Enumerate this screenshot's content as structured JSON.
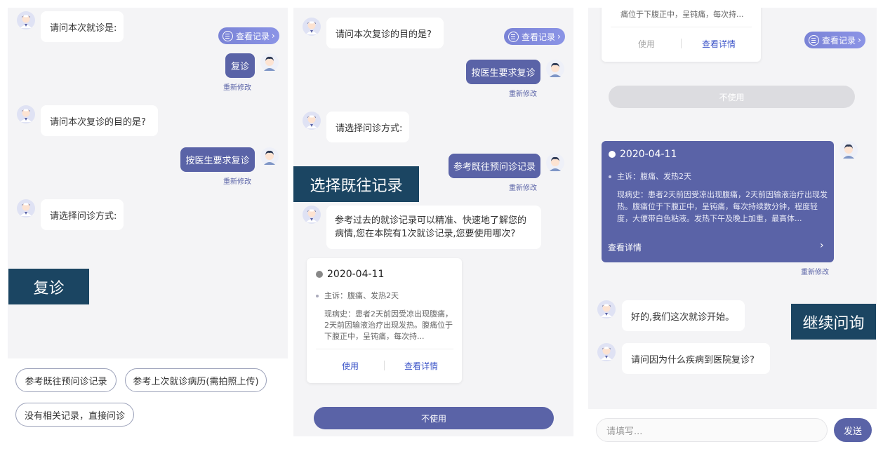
{
  "labels": {
    "p1": "复诊",
    "p2": "选择既往记录",
    "p3": "继续问询"
  },
  "record_button": "查看记录",
  "modify": "重新修改",
  "panel1": {
    "q1": "请问本次就诊是:",
    "a1": "复诊",
    "q2": "请问本次复诊的目的是?",
    "a2": "按医生要求复诊",
    "q3": "请选择问诊方式:",
    "options": [
      "参考既往预问诊记录",
      "参考上次就诊病历(需拍照上传)",
      "没有相关记录，直接问诊"
    ]
  },
  "panel2": {
    "q1": "请问本次复诊的目的是?",
    "a1": "按医生要求复诊",
    "q2": "请选择问诊方式:",
    "a2": "参考既往预问诊记录",
    "msg": "参考过去的就诊记录可以精准、快速地了解您的病情,您在本院有1次就诊记录,您要使用哪次?",
    "card": {
      "date": "2020-04-11",
      "complaint": "主诉：腹痛、发热2天",
      "history": "现病史：患者2天前因受凉出现腹痛，2天前因输液治疗出现发热。腹痛位于下腹正中，呈钝痛，每次持...",
      "use": "使用",
      "detail": "查看详情"
    },
    "no_use": "不使用"
  },
  "panel3": {
    "top_card": {
      "text": "痛位于下腹正中，呈钝痛，每次持...",
      "use": "使用",
      "detail": "查看详情"
    },
    "no_use": "不使用",
    "card": {
      "date": "2020-04-11",
      "complaint": "主诉：腹痛、发热2天",
      "history": "现病史：患者2天前因受凉出现腹痛，2天前因输液治疗出现发热。腹痛位于下腹正中，呈钝痛，每次持续数分钟，程度轻度，大便带白色粘液。发热下午及晚上加重，最高体...",
      "detail": "查看详情"
    },
    "q1": "好的,我们这次就诊开始。",
    "q2": "请问因为什么疾病到医院复诊?",
    "input_placeholder": "请填写...",
    "send": "发送"
  },
  "colors": {
    "primary": "#5a63a7",
    "label_bg": "#1b4562",
    "link": "#3c54c8"
  },
  "icons": {
    "bot": "doctor-avatar-icon",
    "user": "patient-avatar-icon",
    "record": "list-icon",
    "chevron": "chevron-right-icon"
  }
}
